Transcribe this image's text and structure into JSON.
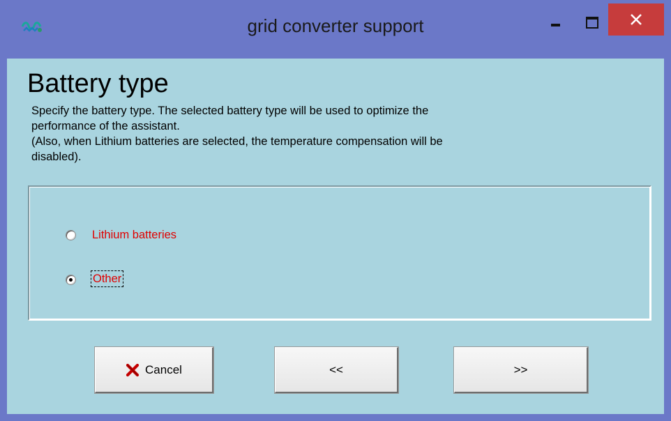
{
  "window": {
    "title": "grid converter support",
    "colors": {
      "frame": "#6b78c8",
      "client": "#a9d4df",
      "close": "#c63c3c",
      "label": "#e00000"
    }
  },
  "page": {
    "title": "Battery type",
    "description_lines": [
      "Specify the battery type. The selected battery type will be used to optimize the",
      "performance of the assistant.",
      "(Also, when Lithium batteries are selected, the temperature compensation will be",
      "disabled)."
    ]
  },
  "options": [
    {
      "label": "Lithium batteries",
      "selected": false
    },
    {
      "label": "Other",
      "selected": true
    }
  ],
  "buttons": {
    "cancel": {
      "label": "Cancel",
      "icon": "red-x-icon"
    },
    "back": {
      "label": "<<"
    },
    "next": {
      "label": ">>"
    }
  }
}
